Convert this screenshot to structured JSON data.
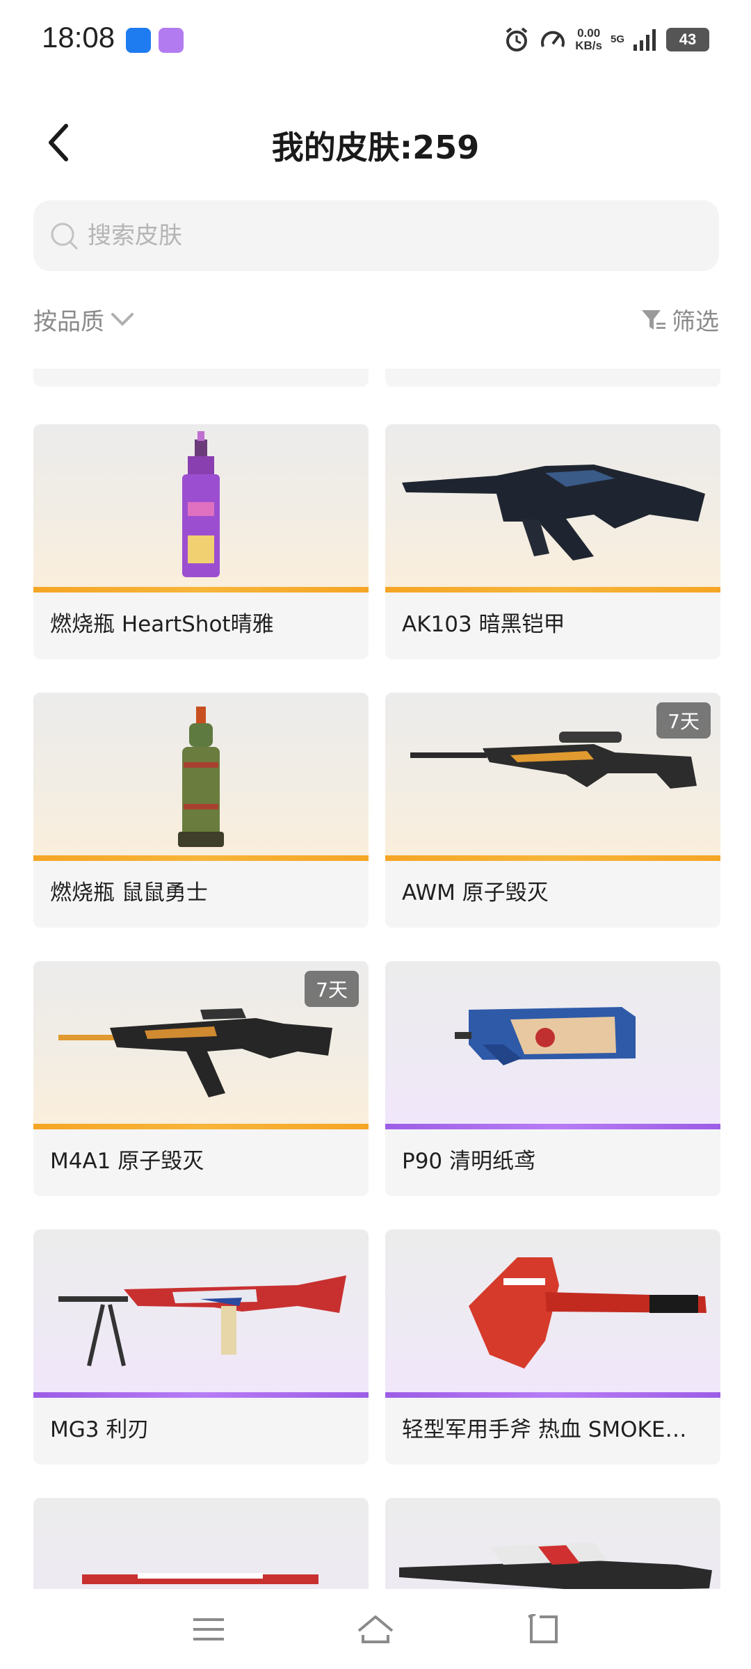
{
  "status_bar": {
    "time": "18:08",
    "speed_value": "0.00",
    "speed_unit": "KB/s",
    "network": "5G",
    "battery": "43"
  },
  "header": {
    "title": "我的皮肤:259"
  },
  "search": {
    "placeholder": "搜索皮肤"
  },
  "sort": {
    "label": "按品质"
  },
  "filter": {
    "label": "筛选"
  },
  "skins": [
    {
      "name": "燃烧瓶 HeartShot晴雅",
      "rarity": "gold",
      "badge": ""
    },
    {
      "name": "AK103 暗黑铠甲",
      "rarity": "gold",
      "badge": ""
    },
    {
      "name": "燃烧瓶 鼠鼠勇士",
      "rarity": "gold",
      "badge": ""
    },
    {
      "name": "AWM 原子毁灭",
      "rarity": "gold",
      "badge": "7天"
    },
    {
      "name": "M4A1 原子毁灭",
      "rarity": "gold",
      "badge": "7天"
    },
    {
      "name": "P90 清明纸鸢",
      "rarity": "purple",
      "badge": ""
    },
    {
      "name": "MG3 利刃",
      "rarity": "purple",
      "badge": ""
    },
    {
      "name": "轻型军用手斧 热血 SMOKE…",
      "rarity": "purple",
      "badge": ""
    }
  ],
  "colors": {
    "gold": "#f5a524",
    "purple": "#9b5de5"
  }
}
